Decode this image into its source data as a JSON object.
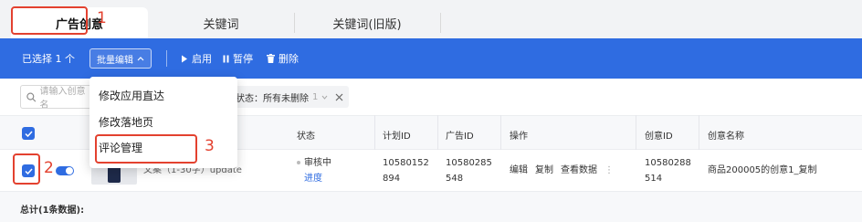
{
  "tabs": [
    {
      "label": "广告创意",
      "active": true
    },
    {
      "label": "关键词",
      "active": false
    },
    {
      "label": "关键词(旧版)",
      "active": false
    }
  ],
  "toolbar": {
    "selected_text": "已选择 1 个",
    "batch_edit_label": "批量编辑",
    "enable_label": "启用",
    "pause_label": "暂停",
    "delete_label": "删除"
  },
  "batch_menu": {
    "items": [
      "修改应用直达",
      "修改落地页",
      "评论管理"
    ]
  },
  "filter": {
    "search_placeholder": "请输入创意名",
    "status_chip": "状态：所有未删除",
    "status_chip_count": "1"
  },
  "table": {
    "headers": {
      "status": "状态",
      "plan_id": "计划ID",
      "ad_id": "广告ID",
      "actions": "操作",
      "creative_id": "创意ID",
      "creative_name": "创意名称"
    },
    "row": {
      "copy_text": "文案（1-30字）update",
      "status": "审核中",
      "status_link": "进度",
      "plan_id_line1": "10580152",
      "plan_id_line2": "894",
      "ad_id_line1": "10580285",
      "ad_id_line2": "548",
      "action_edit": "编辑",
      "action_copy": "复制",
      "action_view": "查看数据",
      "creative_id_line1": "10580288",
      "creative_id_line2": "514",
      "creative_name": "商品200005的创意1_复制"
    },
    "total": "总计(1条数据):"
  },
  "annotations": [
    "1",
    "2",
    "3"
  ],
  "colors": {
    "accent": "#2f6ce1",
    "annotation_red": "#e3412f"
  }
}
